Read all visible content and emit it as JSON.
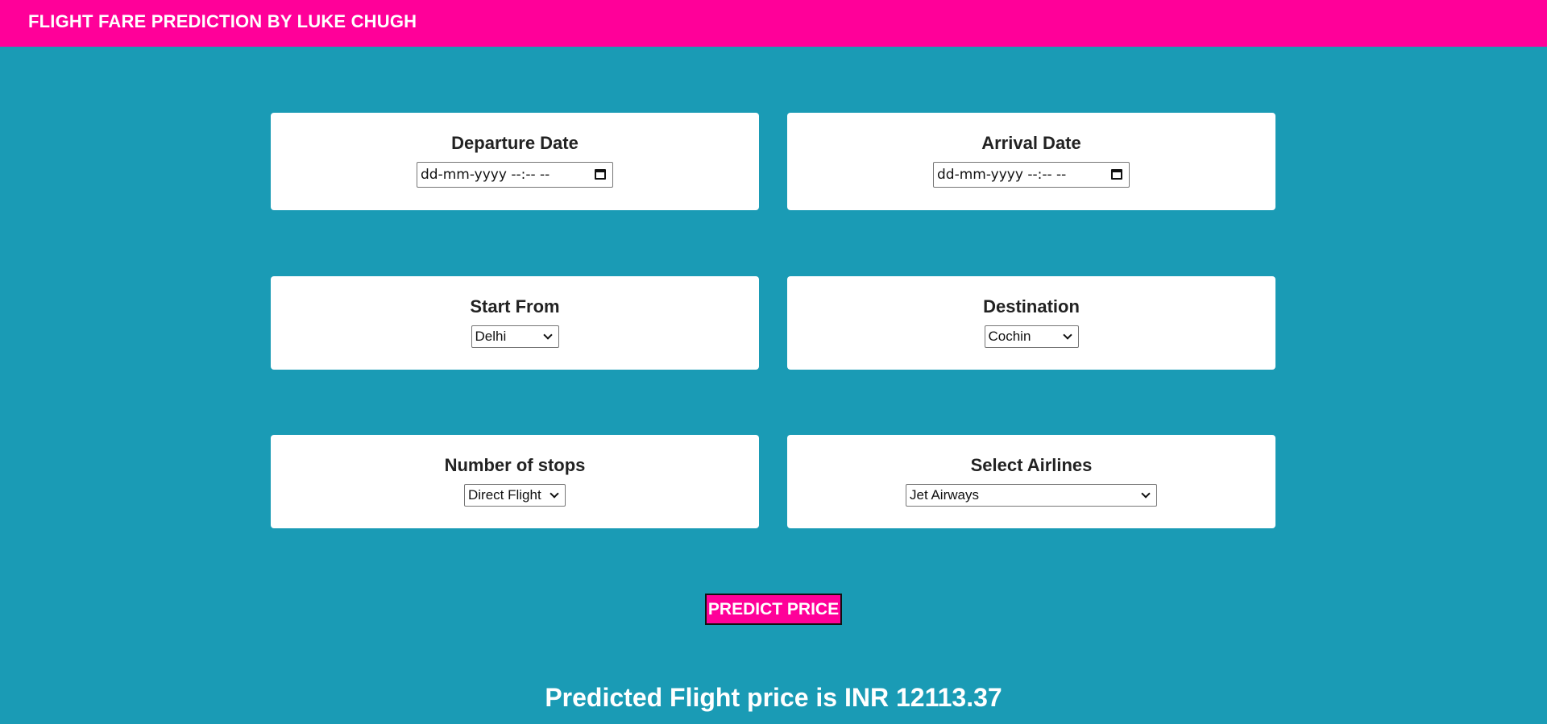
{
  "header": {
    "title": "FLIGHT FARE PREDICTION BY LUKE CHUGH"
  },
  "colors": {
    "accent": "#ff0099",
    "background": "#1a9bb5",
    "card": "#ffffff"
  },
  "form": {
    "departure": {
      "label": "Departure Date",
      "placeholder": "dd-mm-yyyy --:-- --"
    },
    "arrival": {
      "label": "Arrival Date",
      "placeholder": "dd-mm-yyyy --:-- --"
    },
    "source": {
      "label": "Start From",
      "selected": "Delhi"
    },
    "destination": {
      "label": "Destination",
      "selected": "Cochin"
    },
    "stops": {
      "label": "Number of stops",
      "selected": "Direct Flight"
    },
    "airline": {
      "label": "Select Airlines",
      "selected": "Jet Airways"
    },
    "submit_label": "PREDICT PRICE"
  },
  "result": {
    "text": "Predicted Flight price is INR 12113.37"
  },
  "icons": {
    "calendar": "calendar-icon",
    "dropdown": "chevron-down-icon"
  }
}
